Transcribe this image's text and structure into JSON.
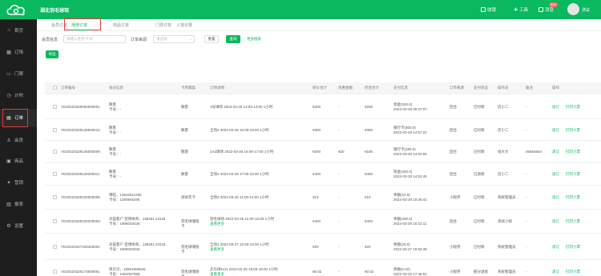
{
  "header": {
    "brand": "湖北羽毛球馆",
    "nav": [
      {
        "label": "收银",
        "icon": "cashier-icon"
      },
      {
        "label": "工具",
        "icon": "tools-icon"
      },
      {
        "label": "消息",
        "icon": "message-icon"
      }
    ],
    "badge": "999",
    "user": "测试"
  },
  "sidebar": {
    "items": [
      {
        "label": "首页",
        "icon": "home-icon"
      },
      {
        "label": "订场",
        "icon": "venue-booking-icon"
      },
      {
        "label": "门票",
        "icon": "ticket-icon"
      },
      {
        "label": "计时",
        "icon": "timer-icon"
      },
      {
        "label": "订单",
        "icon": "order-icon"
      },
      {
        "label": "会员",
        "icon": "member-icon"
      },
      {
        "label": "商品",
        "icon": "goods-icon"
      },
      {
        "label": "营销",
        "icon": "marketing-icon"
      },
      {
        "label": "报表",
        "icon": "report-icon"
      },
      {
        "label": "设置",
        "icon": "settings-icon"
      }
    ],
    "active": "订单"
  },
  "tabs": [
    "会员订单",
    "场地订单",
    "商品订单",
    "门票订单",
    "入馆记录"
  ],
  "active_tab": "场地订单",
  "filters": {
    "member_label": "会员信息",
    "member_placeholder": "请输入姓名/卡号",
    "source_label": "订单来源",
    "source_placeholder": "请选择",
    "reset_label": "重置",
    "query_label": "查询",
    "more_label": "更多搜索"
  },
  "export_label": "导出",
  "table": {
    "headers": [
      "订单编号",
      "会员信息",
      "卡所属类",
      "订场详情",
      "原价合计",
      "优惠金额",
      "折后合计",
      "支付信息",
      "订单来源",
      "支付状态",
      "操作员",
      "备注",
      "操作"
    ],
    "rows": [
      {
        "id": "YD20220329093600001",
        "member": "散客",
        "card": "卡号：-",
        "cardtype": "散客",
        "detail": "1号球场 2022-03-29 13:00-14:00  1小时",
        "more": "",
        "price": "¥200",
        "discount": "-",
        "after": "¥200",
        "pay": "现金(200.0)",
        "paytime": "2022-03-29 09:37:07",
        "source": "后台",
        "status": "已付款",
        "operator": "店小二",
        "note": "-"
      },
      {
        "id": "YD20220328145600012",
        "member": "散客",
        "card": "卡号：-",
        "cardtype": "散客",
        "detail": "全场2 2022-03-26 15:00-18:00  1小时",
        "more": "",
        "price": "¥300",
        "discount": "-",
        "after": "¥300",
        "pay": "银行卡(300.0)",
        "paytime": "2022-03-28 14:57:22",
        "source": "后台",
        "status": "已付款",
        "operator": "店小二",
        "note": "-"
      },
      {
        "id": "YD20220328145000009",
        "member": "散客",
        "card": "卡号：-",
        "cardtype": "散客",
        "detail": "1A2球场 2022-03-26 16:00-17:00  1小时",
        "more": "",
        "price": "¥200",
        "discount": "¥20",
        "after": "¥180",
        "pay": "银行卡(180.0)",
        "paytime": "2022-03-28 14:53:55",
        "source": "后台",
        "status": "已付款",
        "operator": "张大大",
        "note": "45654654"
      },
      {
        "id": "YD20220328145200011",
        "member": "散客",
        "card": "卡号：-",
        "cardtype": "散客",
        "detail": "全场2 2022-03-26 17:00-18:00  1小时",
        "more": "",
        "price": "¥400",
        "discount": "-",
        "after": "¥400",
        "pay": "现金(400.0)",
        "paytime": "2022-03-28 14:52:45",
        "source": "后台",
        "status": "已退款",
        "operator": "店小二",
        "note": "-"
      },
      {
        "id": "YD20220328102600006",
        "member": "傅旺，13542611392",
        "card": "卡号：1290945296",
        "cardtype": "测试年卡",
        "detail": "全场3 2022-03-26 11:00-12:00  1小时",
        "more": "",
        "price": "¥10",
        "discount": "-",
        "after": "¥10",
        "pay": "余额(10.0)",
        "paytime": "2022-03-28 10:26:41",
        "source": "小程序",
        "status": "已付款",
        "operator": "系统管理员",
        "note": "-"
      },
      {
        "id": "YD20220328102200003",
        "member": "天猫客户 亚博体育，138451 24118",
        "card": "卡号：1908033426",
        "cardtype": "羽毛球储值卡",
        "detail": "羽毛球场 2022-03-26 11:00-12:00  1小时",
        "more": "查看更多",
        "price": "¥400",
        "discount": "-",
        "after": "¥400",
        "pay": "余额(400.0)",
        "paytime": "2022-03-28 10:22:11",
        "source": "后台",
        "status": "已付款",
        "operator": "测试小如",
        "note": "-"
      },
      {
        "id": "YD20220327105400002",
        "member": "天猫客户 亚博体育，138451 24118",
        "card": "卡号：1908033426",
        "cardtype": "羽毛球储值卡",
        "detail": "全场1 2022-03-27 12:00-13:00  1小时",
        "more": "查看更多",
        "price": "¥20",
        "discount": "-",
        "after": "¥20",
        "pay": "余额(20.0)",
        "paytime": "2022-03-27 10:54:39",
        "source": "小程序",
        "status": "已付款",
        "operator": "系统管理员",
        "note": "-"
      },
      {
        "id": "YD20220326174600001",
        "member": "周贝贝，15901906626",
        "card": "卡号：1363457956",
        "cardtype": "羽毛球储值卡",
        "detail": "乒乓球1111 2022-03-26 18:00-19:00  1小时",
        "more": "查看更多",
        "price": "¥0.02",
        "discount": "-",
        "after": "¥0.02",
        "pay": "余额(0.02)",
        "paytime": "2022-03-26 17:46:51",
        "source": "小程序",
        "status": "部分退款",
        "operator": "系统管理员",
        "note": "-"
      }
    ],
    "actions": {
      "primary": "退订",
      "secondary": "打印小票"
    }
  }
}
